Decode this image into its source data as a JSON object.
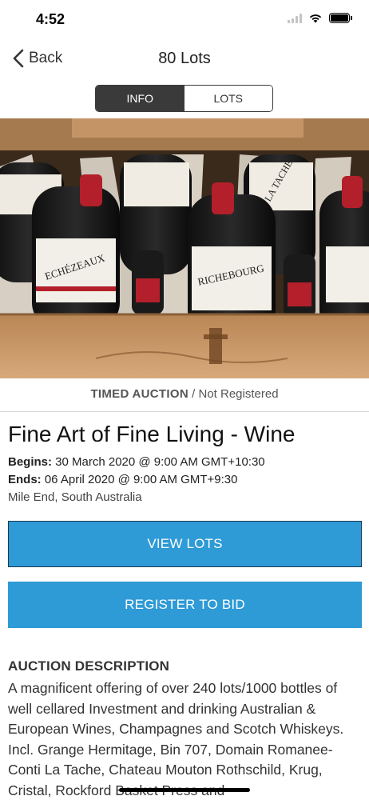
{
  "status_bar": {
    "time": "4:52"
  },
  "nav": {
    "back_label": "Back",
    "title": "80 Lots"
  },
  "tabs": [
    {
      "label": "INFO",
      "active": true
    },
    {
      "label": "LOTS",
      "active": false
    }
  ],
  "hero": {
    "bottle_labels": [
      "ECHÉZEAUX",
      "RICHEBOURG",
      "LA TACHE"
    ]
  },
  "auction": {
    "type": "TIMED AUCTION",
    "separator": " / ",
    "registration_status": "Not Registered",
    "title": "Fine Art of Fine Living - Wine",
    "begins_label": "Begins:",
    "begins_value": " 30 March 2020 @ 9:00 AM GMT+10:30",
    "ends_label": "Ends:",
    "ends_value": " 06 April 2020 @ 9:00 AM GMT+9:30",
    "location": "Mile End, South Australia"
  },
  "buttons": {
    "view_lots": "VIEW LOTS",
    "register": "REGISTER TO BID"
  },
  "description": {
    "heading": "AUCTION DESCRIPTION",
    "body": "A magnificent offering of over 240 lots/1000 bottles of well cellared Investment and drinking Australian & European Wines, Champagnes and Scotch Whiskeys. Incl. Grange Hermitage, Bin 707, Domain Romanee-Conti La Tache, Chateau Mouton Rothschild, Krug, Cristal, Rockford Basket Press and"
  },
  "colors": {
    "primary_button": "#2e9ad6",
    "segment_active": "#3a3a3a",
    "crate_wood": "#c99a6a"
  }
}
